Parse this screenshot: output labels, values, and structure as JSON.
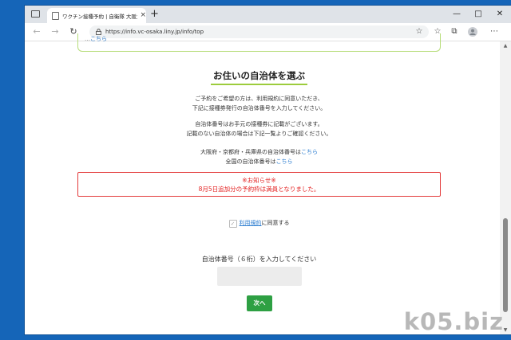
{
  "browser": {
    "tab_title": "ワクチン接種予約 | 自衛隊 大阪大…",
    "tab_close": "×",
    "new_tab": "+",
    "window_controls": {
      "minimize": "—",
      "maximize": "□",
      "close": "✕"
    },
    "url": "https://info.vc-osaka.liny.jp/info/top"
  },
  "notice_top": {
    "text": "…",
    "link": "こちら"
  },
  "page": {
    "heading": "お住いの自治体を選ぶ",
    "intro_line1": "ご予約をご希望の方は、利用規約に同意いただき、",
    "intro_line2": "下記に接種券発行の自治体番号を入力してください。",
    "info_line1": "自治体番号はお手元の接種券に記載がございます。",
    "info_line2": "記載のない自治体の場合は下記一覧よりご確認ください。",
    "osaka_text": "大阪府・京都府・兵庫県の自治体番号は",
    "osaka_link": "こちら",
    "national_text": "全国の自治体番号は",
    "national_link": "こちら",
    "alert_title": "※お知らせ※",
    "alert_body": "8月5日追加分の予約枠は満員となりました。",
    "terms_link": "利用規約",
    "terms_suffix": "に同意する",
    "code_label": "自治体番号（６桁）を入力してください",
    "code_placeholder": "",
    "next_button": "次へ"
  },
  "watermark": "k05.biz",
  "colors": {
    "desktop": "#1565b8",
    "accent_green": "#9ccc3c",
    "alert_red": "#e33b3b",
    "button_green": "#2ea043",
    "link_blue": "#2f7fd1"
  }
}
